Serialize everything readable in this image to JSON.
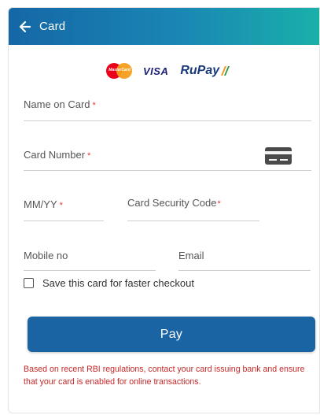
{
  "header": {
    "title": "Card",
    "back_icon": "arrow-left-icon"
  },
  "logos": {
    "mastercard_text": "MasterCard",
    "visa_text": "VISA",
    "rupay_text": "RuPay"
  },
  "form": {
    "name": {
      "label": "Name on Card",
      "required": "*"
    },
    "number": {
      "label": "Card Number",
      "required": "*",
      "icon": "credit-card-icon"
    },
    "expiry": {
      "label": "MM/YY",
      "required": "*"
    },
    "cvv": {
      "label": "Card Security Code",
      "required": "*"
    },
    "mobile": {
      "label": "Mobile no"
    },
    "email": {
      "label": "Email"
    }
  },
  "save_card": {
    "label": "Save this card for faster checkout",
    "checked": false
  },
  "pay_button": {
    "label": "Pay"
  },
  "note": "Based on recent RBI regulations, contact your card issuing bank and ensure that your card is enabled for online transactions.",
  "colors": {
    "header_start": "#1567a6",
    "header_end": "#19b0aa",
    "button": "#1a64a3",
    "required": "#e53935",
    "note": "#c62828"
  }
}
